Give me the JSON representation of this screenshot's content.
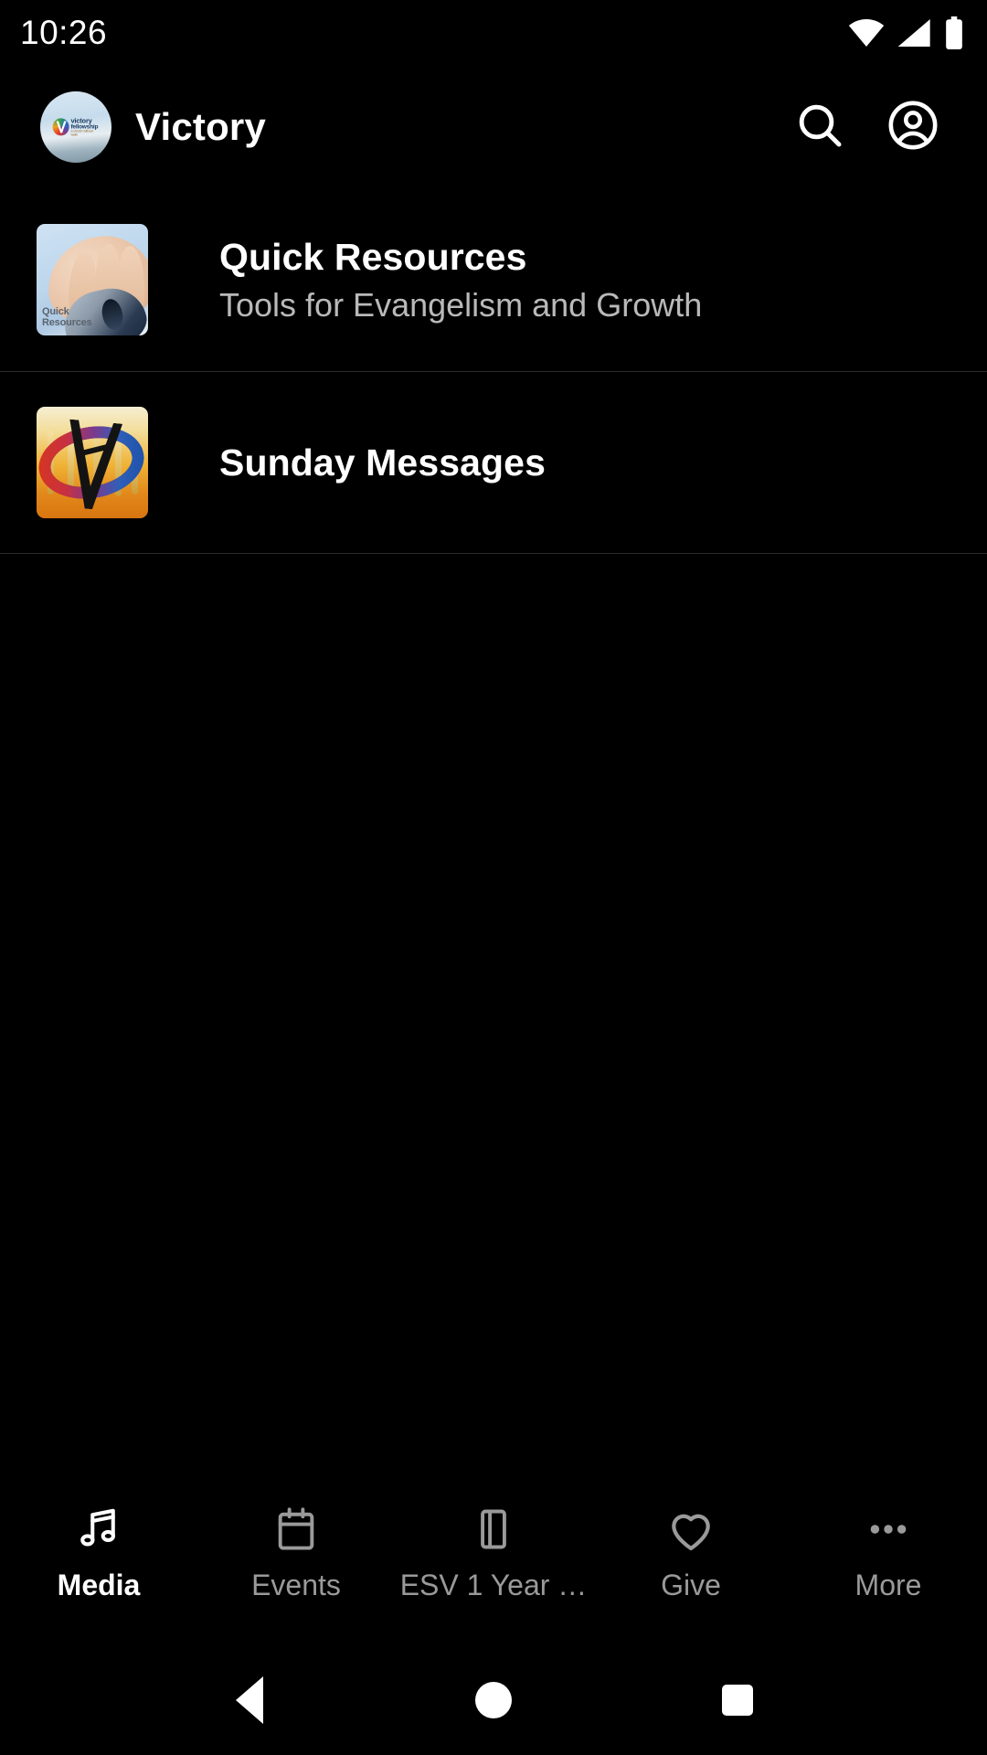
{
  "status_bar": {
    "time": "10:26",
    "icons": [
      "wifi-icon",
      "cellular-signal-icon",
      "battery-icon"
    ]
  },
  "app_bar": {
    "logo_alt": "victory-fellowship-logo",
    "logo_text_line1": "victory",
    "logo_text_line2": "fellowship",
    "logo_text_line3": "a church without walls",
    "title": "Victory",
    "search_icon": "search-icon",
    "account_icon": "account-circle-icon"
  },
  "main": {
    "items": [
      {
        "title": "Quick Resources",
        "subtitle": "Tools for Evangelism and Growth",
        "thumbnail": "hand-on-computer-mouse-image",
        "thumbnail_caption_line1": "Quick",
        "thumbnail_caption_line2": "Resources"
      },
      {
        "title": "Sunday Messages",
        "subtitle": "",
        "thumbnail": "victory-wheat-field-logo-image"
      }
    ]
  },
  "bottom_nav": {
    "items": [
      {
        "label": "Media",
        "icon": "music-note-icon",
        "active": true
      },
      {
        "label": "Events",
        "icon": "calendar-icon",
        "active": false
      },
      {
        "label": "ESV 1 Year …",
        "icon": "book-icon",
        "active": false
      },
      {
        "label": "Give",
        "icon": "heart-icon",
        "active": false
      },
      {
        "label": "More",
        "icon": "more-horizontal-icon",
        "active": false
      }
    ]
  },
  "system_nav": {
    "back": "back-triangle-icon",
    "home": "home-circle-icon",
    "recents": "recents-square-icon"
  },
  "colors": {
    "background": "#000000",
    "primary_text": "#ffffff",
    "secondary_text": "#b9b9b9",
    "inactive_nav": "#9a9a9a",
    "divider": "#2b2b2b"
  }
}
